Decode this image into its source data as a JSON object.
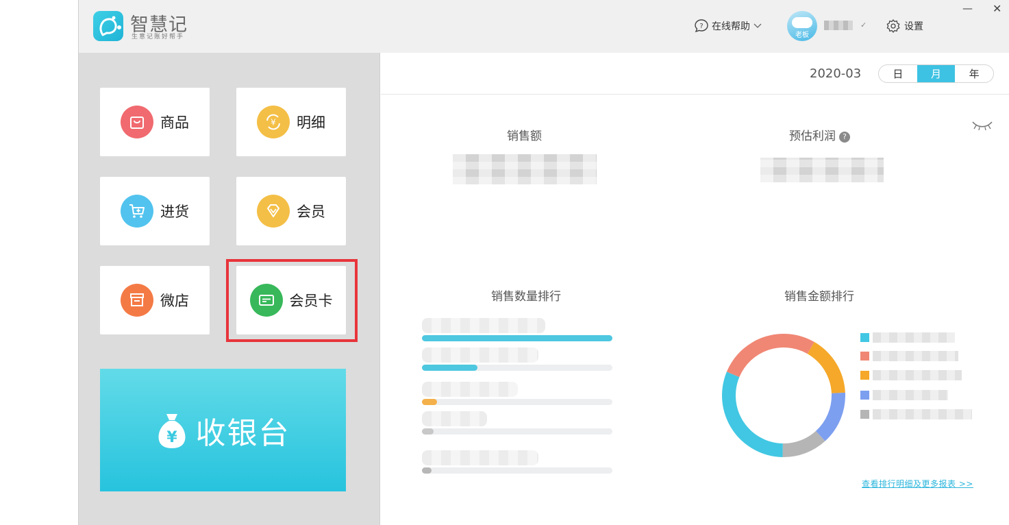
{
  "app": {
    "name": "智慧记",
    "slogan": "生意记账好帮手",
    "online_help": "在线帮助",
    "avatar_tag": "老板",
    "settings": "设置",
    "minimize_glyph": "—",
    "close_glyph": "✕"
  },
  "sidebar": {
    "tiles": [
      {
        "label": "商品",
        "icon": "shopping-bag-icon",
        "color": "#f06a6f"
      },
      {
        "label": "明细",
        "icon": "yuan-refresh-icon",
        "color": "#f4bf46"
      },
      {
        "label": "进货",
        "icon": "cart-plus-icon",
        "color": "#52c3ee"
      },
      {
        "label": "会员",
        "icon": "diamond-icon",
        "color": "#f4bf46"
      },
      {
        "label": "微店",
        "icon": "storefront-icon",
        "color": "#f47a45"
      },
      {
        "label": "会员卡",
        "icon": "card-icon",
        "color": "#38b85a"
      }
    ],
    "cashier_label": "收银台",
    "cashier_icon": "money-bag-icon",
    "highlight_color": "#e8343b"
  },
  "main": {
    "date": "2020-03",
    "period_tabs": [
      {
        "label": "日",
        "active": false
      },
      {
        "label": "月",
        "active": true
      },
      {
        "label": "年",
        "active": false
      }
    ],
    "accent_color": "#3ec2e3",
    "sales_label": "销售额",
    "profit_label": "预估利润",
    "qty_rank_title": "销售数量排行",
    "amount_rank_title": "销售金额排行",
    "qty_rank_fractions": [
      1.0,
      0.29,
      0.08,
      0.06,
      0.05
    ],
    "qty_rank_colors": [
      "#4ec7e0",
      "#4ec7e0",
      "#f4b04a",
      "#c8c8c8",
      "#b7b7b7"
    ],
    "donut_slices": [
      {
        "fraction": 0.16,
        "color": "#f5a829"
      },
      {
        "fraction": 0.14,
        "color": "#7d9ff0"
      },
      {
        "fraction": 0.12,
        "color": "#b5b5b5"
      },
      {
        "fraction": 0.31,
        "color": "#41c7e3"
      },
      {
        "fraction": 0.27,
        "color": "#f08774"
      }
    ],
    "legend_colors": [
      "#41c7e3",
      "#f08774",
      "#f5a829",
      "#7d9ff0",
      "#b5b5b5"
    ],
    "more_link": "查看排行明细及更多报表 >>"
  }
}
